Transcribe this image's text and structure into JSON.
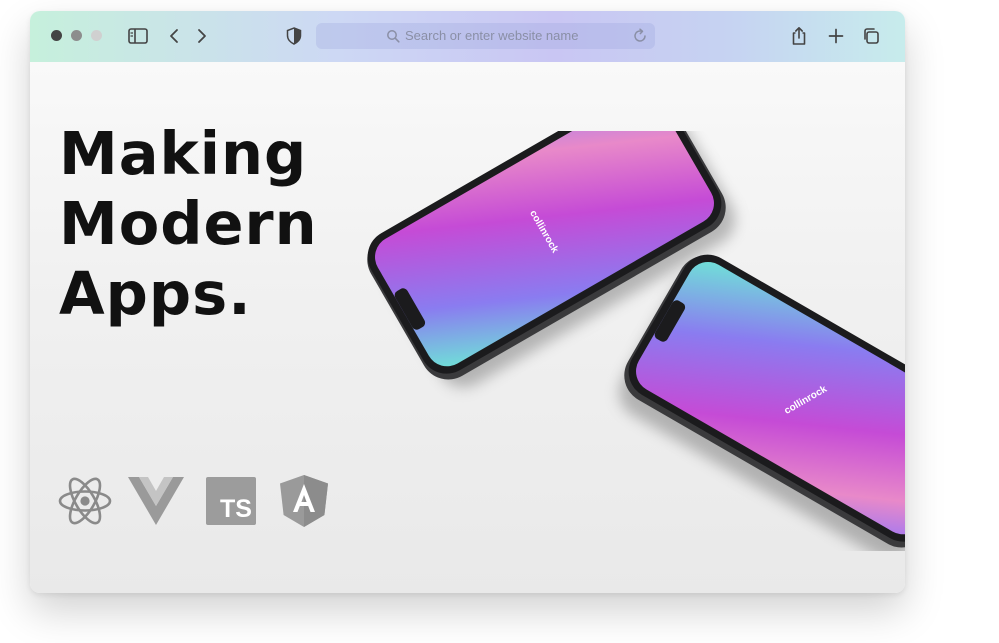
{
  "browser": {
    "url_placeholder": "Search or enter website name",
    "traffic_lights": [
      "#4a4a4a",
      "#8e8e8e",
      "#d4d4d4"
    ]
  },
  "hero": {
    "headline_lines": [
      "Making",
      "Modern",
      "Apps."
    ]
  },
  "tech_icons": [
    "react-icon",
    "vue-icon",
    "typescript-icon",
    "angular-icon"
  ],
  "typescript_badge_label": "TS",
  "phones": {
    "brand_label": "collinrock",
    "screen_gradient": [
      "#6ee7d6",
      "#8a7cf0",
      "#c54bd6",
      "#e889c9"
    ]
  }
}
